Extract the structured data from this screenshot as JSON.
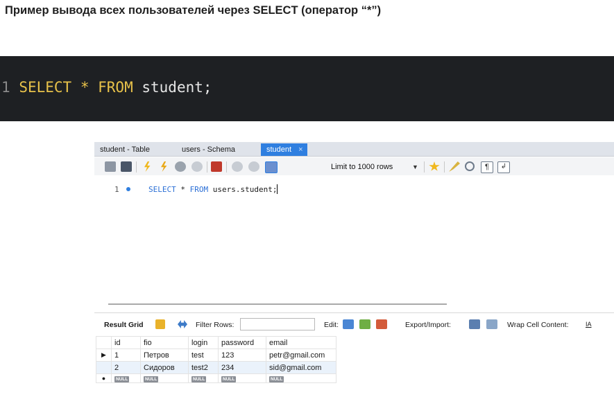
{
  "heading": "Пример вывода всех пользователей через SELECT (оператор “*”)",
  "code_snippet": {
    "line_number": "1",
    "keyword_select": "SELECT",
    "star": "*",
    "keyword_from": "FROM",
    "rest": "student;"
  },
  "tabs": [
    {
      "label": "student - Table"
    },
    {
      "label": "users - Schema"
    },
    {
      "label": "student",
      "close": "×"
    }
  ],
  "toolbar": {
    "limit_label": "Limit to 1000 rows",
    "icons": [
      "open-folder-icon",
      "save-icon",
      "execute-icon",
      "execute-current-icon",
      "explain-icon",
      "stop-icon",
      "toggle-output-icon",
      "commit-icon",
      "rollback-icon",
      "autocommit-icon",
      "favorite-icon",
      "beautify-icon",
      "find-icon",
      "invisible-chars-icon",
      "wrap-icon"
    ]
  },
  "editor": {
    "line_number": "1",
    "kw_select": "SELECT",
    "star": "*",
    "kw_from": "FROM",
    "table": "users.student;"
  },
  "result_bar": {
    "result_grid": "Result Grid",
    "filter_rows": "Filter Rows:",
    "edit": "Edit:",
    "export_import": "Export/Import:",
    "wrap_cell": "Wrap Cell Content:",
    "wrap_glyph": "IA"
  },
  "grid": {
    "columns": [
      "id",
      "fio",
      "login",
      "password",
      "email"
    ],
    "rows": [
      {
        "marker": "▶",
        "id": "1",
        "fio": "Петров",
        "login": "test",
        "password": "123",
        "email": "petr@gmail.com"
      },
      {
        "marker": "",
        "id": "2",
        "fio": "Сидоров",
        "login": "test2",
        "password": "234",
        "email": "sid@gmail.com"
      }
    ],
    "new_row_marker": "●",
    "null_label": "NULL"
  },
  "colors": {
    "code_bg": "#1e2023",
    "code_keyword": "#e8c24a",
    "active_tab": "#2f7fe0",
    "sql_keyword": "#2b6fd6"
  }
}
